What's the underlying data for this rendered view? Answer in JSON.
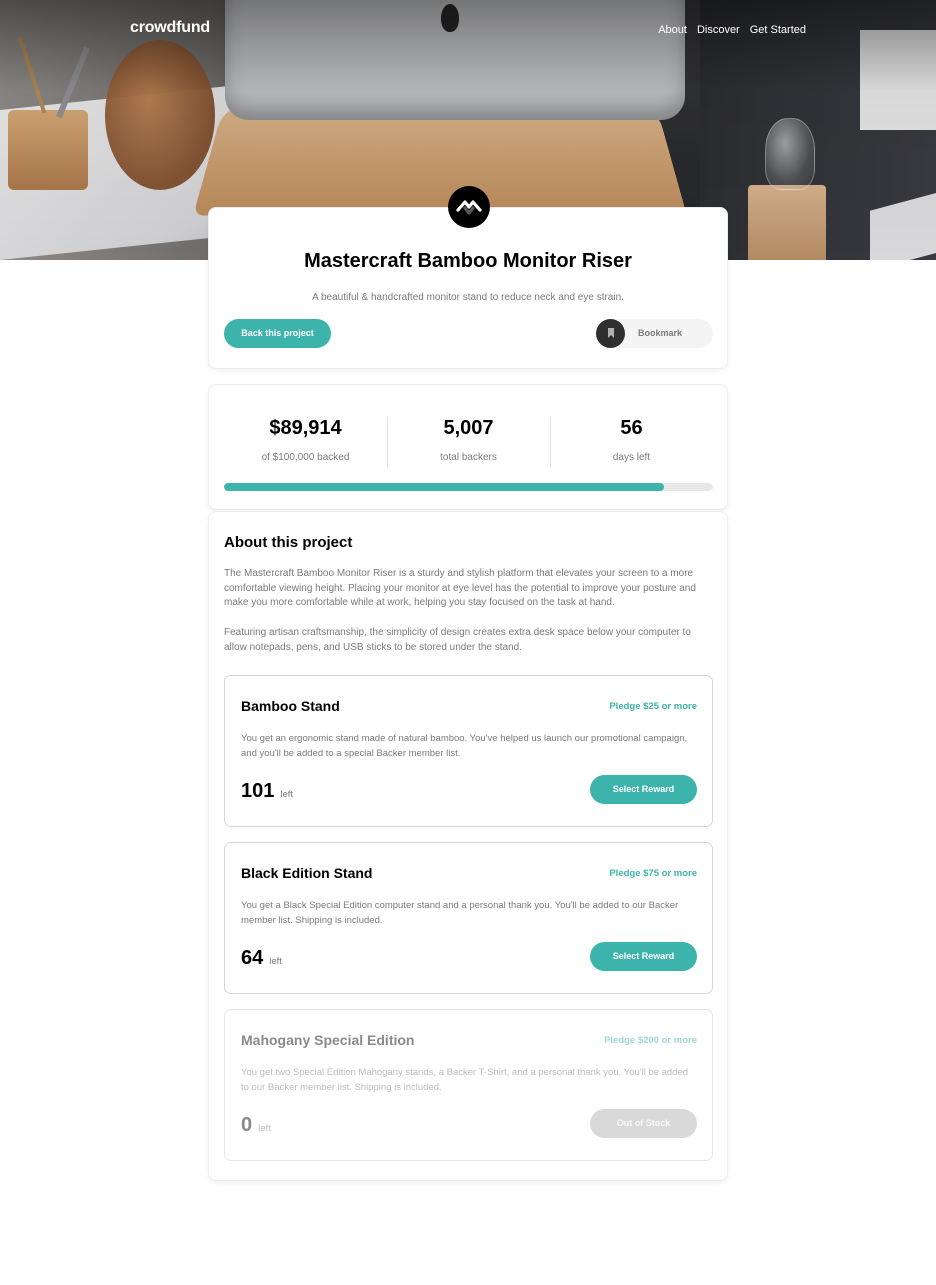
{
  "nav": {
    "logo": "crowdfund",
    "links": [
      "About",
      "Discover",
      "Get Started"
    ]
  },
  "project": {
    "logo_icon": "mastercraft-logo-icon",
    "title": "Mastercraft Bamboo Monitor Riser",
    "description": "A beautiful & handcrafted monitor stand to reduce neck and eye strain.",
    "back_button": "Back this project",
    "bookmark_label": "Bookmark"
  },
  "stats": [
    {
      "value": "$89,914",
      "label": "of $100,000 backed"
    },
    {
      "value": "5,007",
      "label": "total backers"
    },
    {
      "value": "56",
      "label": "days left"
    }
  ],
  "progress_fraction": 0.899,
  "about": {
    "title": "About this project",
    "paragraphs": [
      "The Mastercraft Bamboo Monitor Riser is a sturdy and stylish platform that elevates your screen to a more comfortable viewing height. Placing your monitor at eye level has the potential to improve your posture and make you more comfortable while at work, helping you stay focused on the task at hand.",
      "Featuring artisan craftsmanship, the simplicity of design creates extra desk space below your computer to allow notepads, pens, and USB sticks to be stored under the stand."
    ]
  },
  "rewards": [
    {
      "title": "Bamboo Stand",
      "pledge": "Pledge $25 or more",
      "description": "You get an ergonomic stand made of natural bamboo. You've helped us launch our promotional campaign, and you'll be added to a special Backer member list.",
      "count": "101",
      "left_label": "left",
      "button": "Select Reward"
    },
    {
      "title": "Black Edition Stand",
      "pledge": "Pledge $75 or more",
      "description": "You get a Black Special Edition computer stand and a personal thank you. You'll be added to our Backer member list. Shipping is included.",
      "count": "64",
      "left_label": "left",
      "button": "Select Reward"
    },
    {
      "title": "Mahogany Special Edition",
      "pledge": "Pledge $200 or more",
      "description": "You get two Special Edition Mahogany stands, a Backer T-Shirt, and a personal thank you. You'll be added to our Backer member list. Shipping is included.",
      "count": "0",
      "left_label": "left",
      "button": "Out of Stock"
    }
  ],
  "colors": {
    "accent": "#3cb3ab",
    "accent_dark": "#147a73",
    "text_dark": "#000000",
    "text_gray": "#7a7a7a"
  }
}
